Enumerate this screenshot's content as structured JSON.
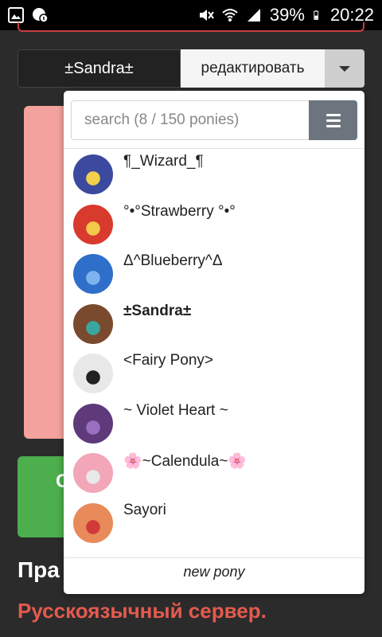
{
  "status_bar": {
    "battery": "39%",
    "time": "20:22",
    "left_icons": [
      "image-icon",
      "chat-info-icon"
    ],
    "right_icons": [
      "mute-icon",
      "wifi-icon",
      "signal-icon",
      "battery-icon"
    ]
  },
  "selector": {
    "current_pony": "±Sandra±",
    "edit_label": "редактировать",
    "toggle_icon": "caret-down-icon"
  },
  "dropdown": {
    "search_placeholder": "search (8 / 150 ponies)",
    "menu_icon": "hamburger-icon",
    "ponies": [
      {
        "name": "¶_Wizard_¶",
        "avatar_color": "#3b4a9e",
        "accent": "#f2d14a",
        "current": false
      },
      {
        "name": "°•°Strawberry °•°",
        "avatar_color": "#d93a2e",
        "accent": "#f2c94a",
        "current": false
      },
      {
        "name": "Δ^Blueberry^Δ",
        "avatar_color": "#2f6fc9",
        "accent": "#7fb3f0",
        "current": false
      },
      {
        "name": "±Sandra±",
        "avatar_color": "#7a4a2e",
        "accent": "#3aa6a0",
        "current": true
      },
      {
        "name": "<Fairy Pony>",
        "avatar_color": "#e8e8e8",
        "accent": "#222222",
        "current": false
      },
      {
        "name": "~ Violet Heart ~",
        "avatar_color": "#5e3a7a",
        "accent": "#9a6fc0",
        "current": false
      },
      {
        "name": "🌸~Calendula~🌸",
        "avatar_color": "#f2a6b8",
        "accent": "#e8e8e8",
        "current": false
      },
      {
        "name": "Sayori",
        "avatar_color": "#e88a5a",
        "accent": "#d23a3a",
        "current": false
      }
    ],
    "new_pony_label": "new pony"
  },
  "background": {
    "green_button_label": "С",
    "rules_title": "Пра",
    "server_text": "Русскоязычный сервер."
  }
}
